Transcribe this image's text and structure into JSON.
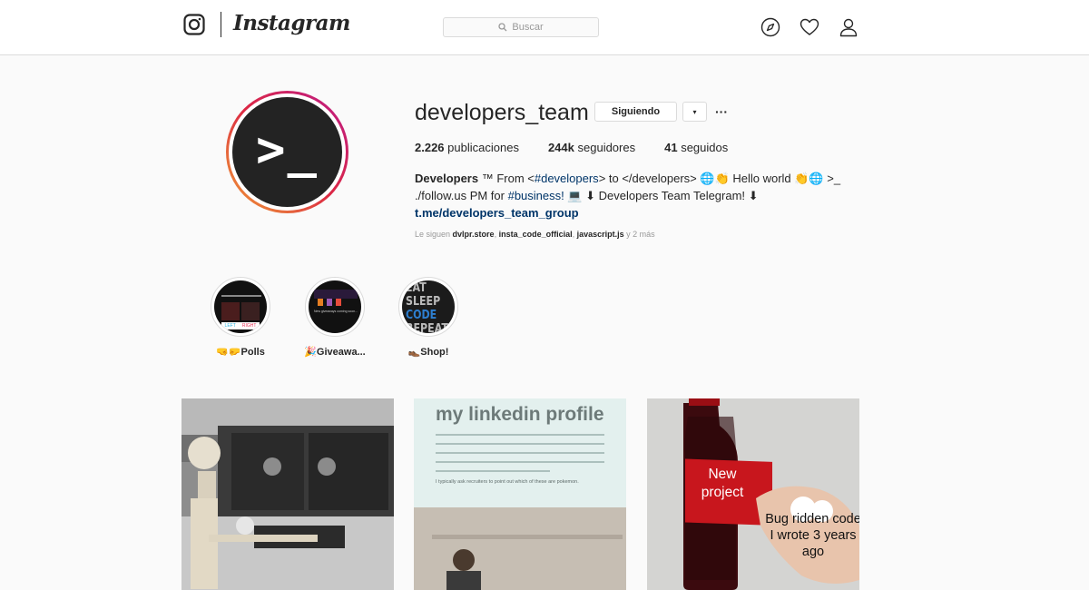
{
  "header": {
    "wordmark": "Instagram",
    "search_placeholder": "Buscar",
    "nav_icons": [
      "compass-icon",
      "heart-icon",
      "user-icon"
    ]
  },
  "profile": {
    "username": "developers_team",
    "avatar_text": ">_",
    "follow_button": "Siguiendo",
    "dropdown_glyph": "▾",
    "more_glyph": "···",
    "stats": [
      {
        "value": "2.226",
        "label": "publicaciones"
      },
      {
        "value": "244k",
        "label": "seguidores"
      },
      {
        "value": "41",
        "label": "seguidos"
      }
    ],
    "bio": {
      "name": "Developers",
      "tm": " ™ From <",
      "hashtag1": "#developers",
      "mid1": "> to </developers> 🌐👏 Hello world 👏🌐     >_",
      "line2a": "./follow.us     PM for ",
      "hashtag2": "#business!",
      "line2b": " 💻   ⬇ Developers Team Telegram! ⬇",
      "link": "t.me/developers_team_group"
    },
    "followed_by": {
      "prefix": "Le siguen ",
      "users": [
        "dvlpr.store",
        "insta_code_official",
        "javascript.js"
      ],
      "suffix": " y 2 más"
    }
  },
  "highlights": [
    {
      "label": "🤜🤛Polls",
      "thumb_a": "LEFT",
      "thumb_b": "RIGHT"
    },
    {
      "label": "🎉Giveawa...",
      "thumb_a": "New giveaways coming soon..."
    },
    {
      "label": "👞Shop!",
      "thumb_lines": [
        "EAT",
        "SLEEP",
        "CODE",
        "REPEAT"
      ]
    }
  ],
  "posts": [
    {
      "name": "skeleton-waiting-post"
    },
    {
      "name": "linkedin-profile-post",
      "title": "my linkedin profile",
      "caption": "I typically ask recruiters to point out which of these are pokemon."
    },
    {
      "name": "new-project-bottle-post",
      "label_a": "New project",
      "label_b": "Bug ridden code I wrote 3 years ago"
    }
  ]
}
